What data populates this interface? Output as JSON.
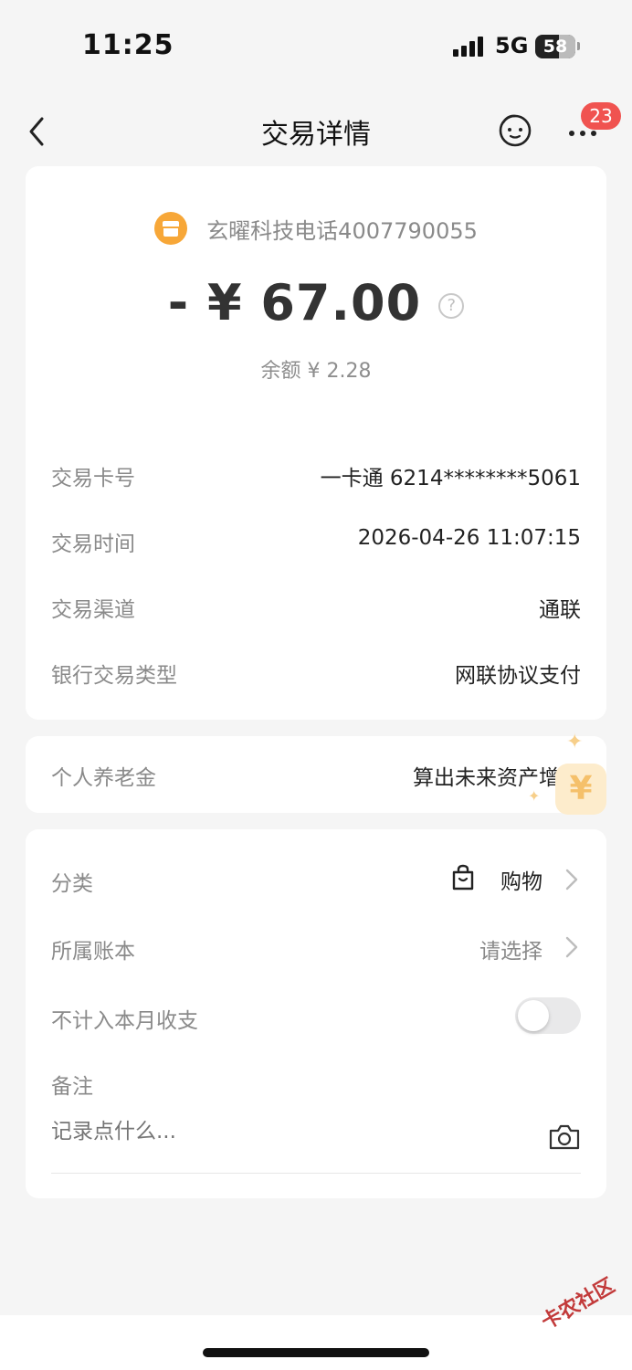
{
  "status_bar": {
    "time": "11:25",
    "network": "5G",
    "battery": "58"
  },
  "nav": {
    "title": "交易详情",
    "badge": "23"
  },
  "transaction": {
    "merchant": "玄曜科技电话4007790055",
    "amount": "- ¥ 67.00",
    "balance": "余额 ¥ 2.28",
    "details": [
      {
        "label": "交易卡号",
        "value": "一卡通 6214********5061"
      },
      {
        "label": "交易时间",
        "value": "2026-04-26 11:07:15"
      },
      {
        "label": "交易渠道",
        "value": "通联"
      },
      {
        "label": "银行交易类型",
        "value": "网联协议支付"
      }
    ]
  },
  "pension": {
    "label": "个人养老金",
    "value": "算出未来资产增幅"
  },
  "settings": {
    "category_label": "分类",
    "category_value": "购物",
    "ledger_label": "所属账本",
    "ledger_value": "请选择",
    "exclude_label": "不计入本月收支",
    "exclude_enabled": false,
    "note_label": "备注",
    "note_placeholder": "记录点什么..."
  },
  "watermark": "卡农社区",
  "icons": [
    "back-icon",
    "face-icon",
    "more-icon",
    "merchant-shop-icon",
    "help-icon",
    "shopping-bag-icon",
    "chevron-right-icon",
    "camera-icon"
  ]
}
